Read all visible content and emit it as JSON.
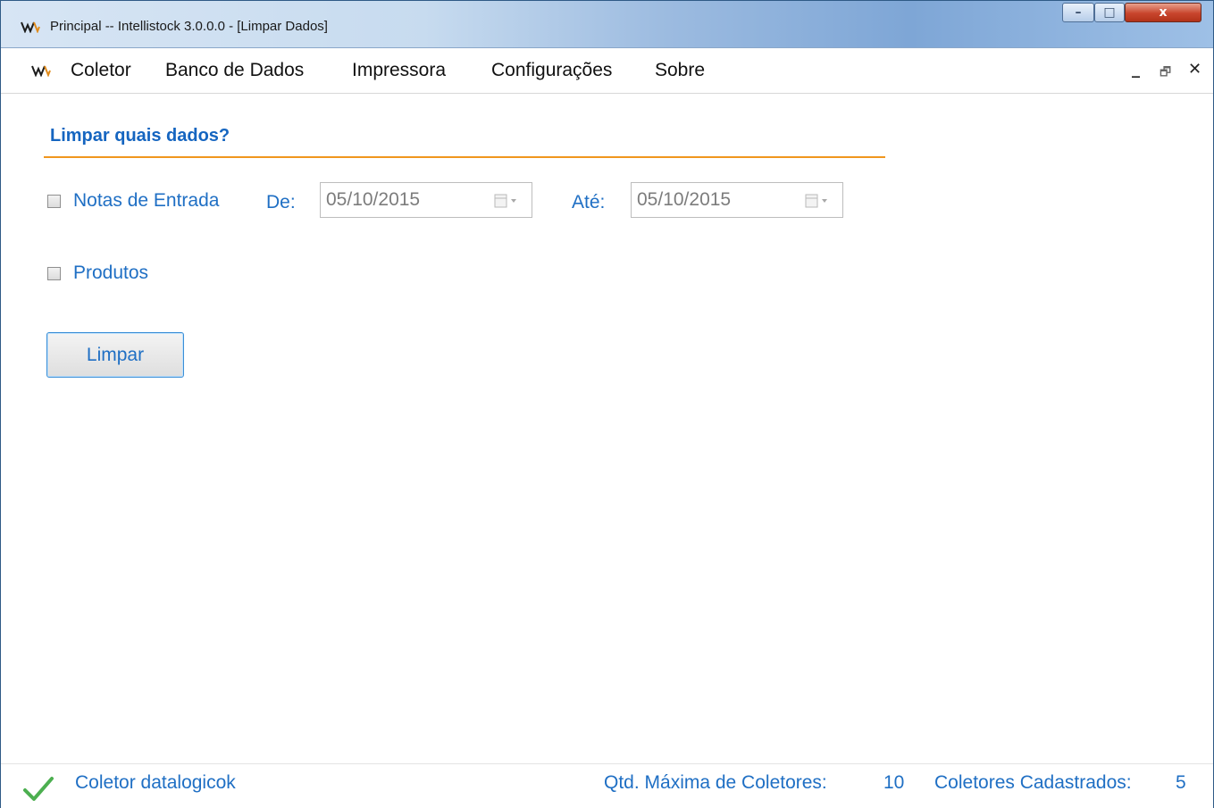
{
  "window": {
    "title": "Principal -- Intellistock 3.0.0.0 - [Limpar Dados]",
    "controls": {
      "minimize": "–",
      "maximize": "□",
      "close": "x"
    }
  },
  "menu": {
    "items": [
      "Coletor",
      "Banco de Dados",
      "Impressora",
      "Configurações",
      "Sobre"
    ],
    "mdi_controls": {
      "minimize": "_",
      "restore": "🗗",
      "close": "✕"
    }
  },
  "form": {
    "heading": "Limpar quais dados?",
    "notas": {
      "label": "Notas de Entrada",
      "checked": false,
      "from_label": "De:",
      "from_value": "05/10/2015",
      "to_label": "Até:",
      "to_value": "05/10/2015"
    },
    "produtos": {
      "label": "Produtos",
      "checked": false
    },
    "button": "Limpar"
  },
  "status": {
    "collector": "Coletor datalogicok",
    "max_label": "Qtd. Máxima de Coletores:",
    "max_value": "10",
    "registered_label": "Coletores Cadastrados:",
    "registered_value": "5"
  },
  "colors": {
    "accent_blue": "#1f6fc4",
    "heading_blue": "#1565c0",
    "rule_orange": "#f0961e",
    "ok_green": "#4caf50"
  },
  "icons": {
    "app_logo": "intellistock-logo-icon",
    "calendar": "calendar-dropdown-icon",
    "status_ok": "checkmark-icon"
  }
}
